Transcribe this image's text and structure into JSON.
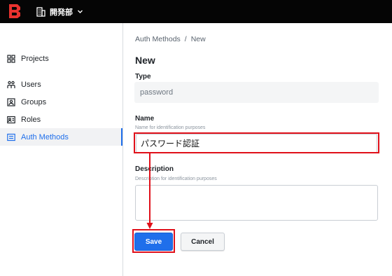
{
  "topbar": {
    "org_name": "開発部"
  },
  "sidebar": {
    "items": [
      {
        "label": "Projects",
        "icon": "grid-icon"
      },
      {
        "label": "Users",
        "icon": "users-icon"
      },
      {
        "label": "Groups",
        "icon": "groups-icon"
      },
      {
        "label": "Roles",
        "icon": "id-card-icon"
      },
      {
        "label": "Auth Methods",
        "icon": "auth-methods-icon",
        "active": true
      }
    ]
  },
  "breadcrumb": {
    "parent": "Auth Methods",
    "separator": "/",
    "current": "New"
  },
  "main": {
    "title": "New",
    "type": {
      "label": "Type",
      "value": "password"
    },
    "name": {
      "label": "Name",
      "hint": "Name for identification purposes",
      "value": "パスワード認証"
    },
    "description": {
      "label": "Description",
      "hint": "Description for identification purposes",
      "value": ""
    },
    "save_label": "Save",
    "cancel_label": "Cancel"
  },
  "colors": {
    "accent": "#1f6feb",
    "annotation": "#e0101a",
    "topbar": "#050505"
  }
}
